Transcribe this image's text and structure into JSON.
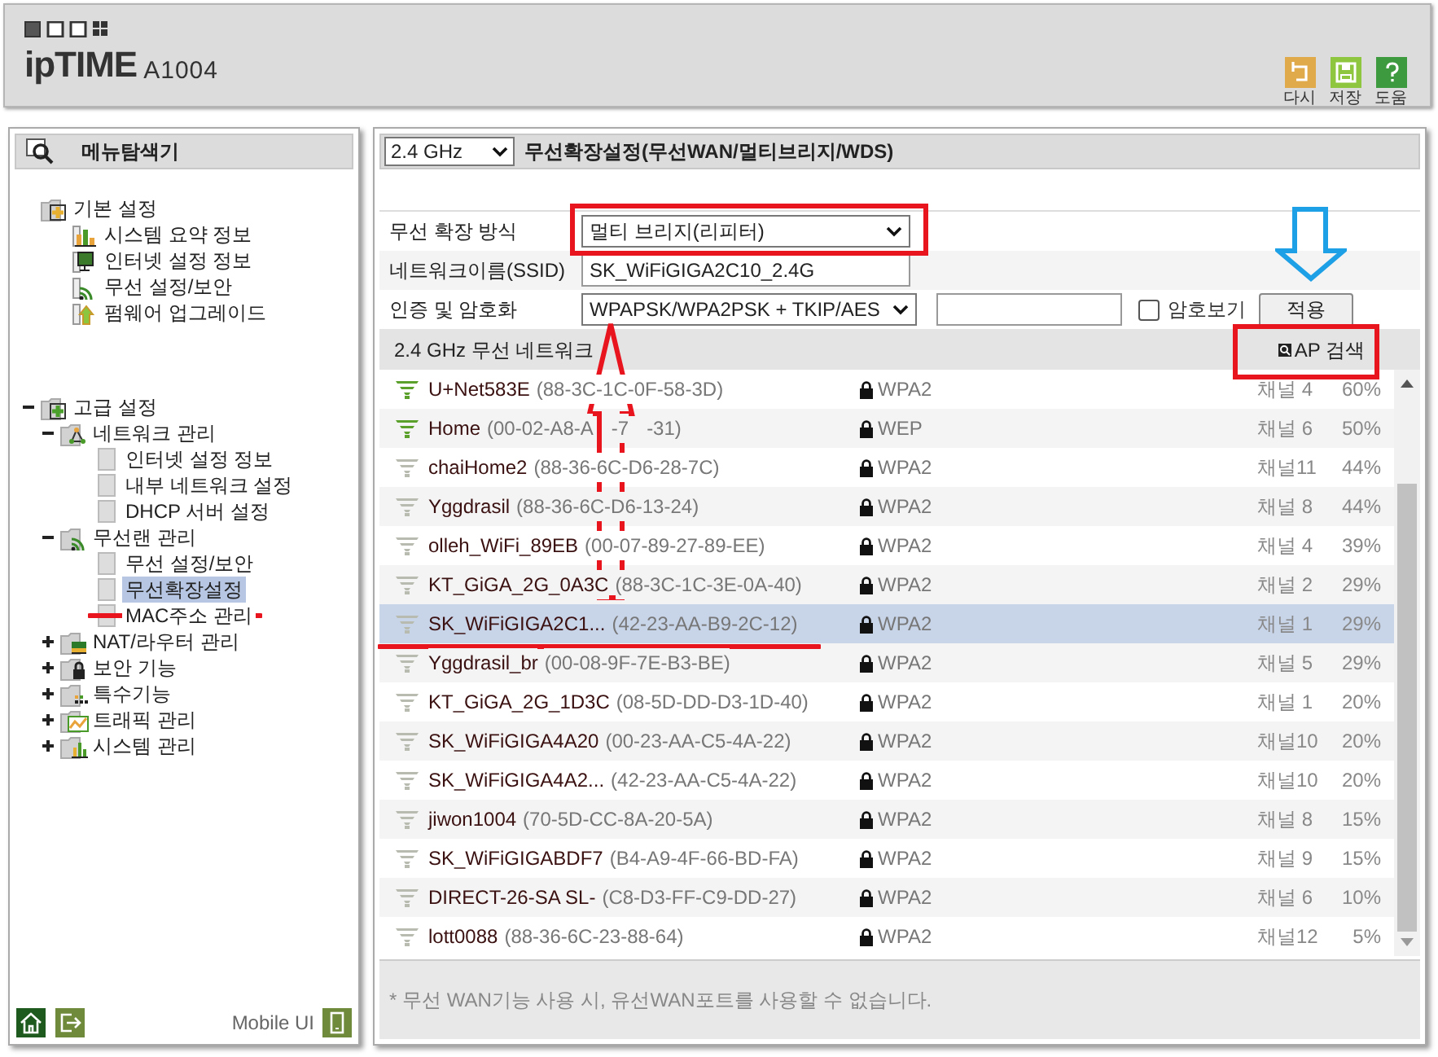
{
  "header": {
    "logo": "ipTIME",
    "model": "A1004",
    "actions": [
      {
        "label": "다시",
        "kind": "undo"
      },
      {
        "label": "저장",
        "kind": "save"
      },
      {
        "label": "도움",
        "kind": "help"
      }
    ]
  },
  "sidebar": {
    "title": "메뉴탐색기",
    "tree": [
      {
        "label": "기본 설정",
        "children": [
          {
            "label": "시스템 요약 정보",
            "selected": false
          },
          {
            "label": "인터넷 설정 정보",
            "selected": false
          },
          {
            "label": "무선 설정/보안",
            "selected": false
          },
          {
            "label": "펌웨어 업그레이드",
            "selected": false
          }
        ]
      },
      {
        "label": "고급 설정",
        "expanded": true,
        "children": [
          {
            "label": "네트워크 관리",
            "expanded": true,
            "children": [
              {
                "label": "인터넷 설정 정보",
                "selected": false
              },
              {
                "label": "내부 네트워크 설정",
                "selected": false
              },
              {
                "label": "DHCP 서버 설정",
                "selected": false
              }
            ]
          },
          {
            "label": "무선랜 관리",
            "expanded": true,
            "children": [
              {
                "label": "무선 설정/보안",
                "selected": false
              },
              {
                "label": "무선확장설정",
                "selected": true
              },
              {
                "label": "MAC주소 관리",
                "selected": false
              }
            ]
          },
          {
            "label": "NAT/라우터 관리",
            "expanded": false
          },
          {
            "label": "보안 기능",
            "expanded": false
          },
          {
            "label": "특수기능",
            "expanded": false
          },
          {
            "label": "트래픽 관리",
            "expanded": false
          },
          {
            "label": "시스템 관리",
            "expanded": false
          }
        ]
      }
    ],
    "mobile_label": "Mobile UI"
  },
  "main": {
    "band": "2.4 GHz",
    "title": "무선확장설정(무선WAN/멀티브리지/WDS)",
    "form": {
      "mode_label": "무선 확장 방식",
      "mode": "멀티 브리지(리피터)",
      "ssid_label": "네트워크이름(SSID)",
      "ssid": "SK_WiFiGIGA2C10_2.4G",
      "auth_label": "인증 및 암호화",
      "auth": "WPAPSK/WPA2PSK + TKIP/AES",
      "show_password_label": "암호보기",
      "show_password": false,
      "apply": "적용"
    },
    "list_title": "2.4 GHz 무선 네트워크",
    "scan_button": "AP 검색",
    "networks": [
      {
        "name": "U+Net583E",
        "bssid": "(88-3C-1C-0F-58-3D)",
        "security": "WPA2",
        "channel": "채널 4",
        "signal": "60%",
        "strong": true,
        "selected": false
      },
      {
        "name": "Home",
        "bssid_parts": [
          "(00-02-A8-A",
          "-7",
          "-31)"
        ],
        "security": "WEP",
        "channel": "채널 6",
        "signal": "50%",
        "strong": true,
        "selected": false
      },
      {
        "name": "chaiHome2",
        "bssid": "(88-36-6C-D6-28-7C)",
        "security": "WPA2",
        "channel": "채널11",
        "signal": "44%",
        "strong": false,
        "selected": false
      },
      {
        "name": "Yggdrasil",
        "bssid": "(88-36-6C-D6-13-24)",
        "security": "WPA2",
        "channel": "채널 8",
        "signal": "44%",
        "strong": false,
        "selected": false
      },
      {
        "name": "olleh_WiFi_89EB",
        "bssid": "(00-07-89-27-89-EE)",
        "security": "WPA2",
        "channel": "채널 4",
        "signal": "39%",
        "strong": false,
        "selected": false
      },
      {
        "name": "KT_GiGA_2G_0A3C",
        "bssid": "(88-3C-1C-3E-0A-40)",
        "security": "WPA2",
        "channel": "채널 2",
        "signal": "29%",
        "strong": false,
        "selected": false
      },
      {
        "name": "SK_WiFiGIGA2C1...",
        "bssid": "(42-23-AA-B9-2C-12)",
        "security": "WPA2",
        "channel": "채널 1",
        "signal": "29%",
        "strong": false,
        "selected": true
      },
      {
        "name": "Yggdrasil_br",
        "bssid": "(00-08-9F-7E-B3-BE)",
        "security": "WPA2",
        "channel": "채널 5",
        "signal": "29%",
        "strong": false,
        "selected": false
      },
      {
        "name": "KT_GiGA_2G_1D3C",
        "bssid": "(08-5D-DD-D3-1D-40)",
        "security": "WPA2",
        "channel": "채널 1",
        "signal": "20%",
        "strong": false,
        "selected": false
      },
      {
        "name": "SK_WiFiGIGA4A20",
        "bssid": "(00-23-AA-C5-4A-22)",
        "security": "WPA2",
        "channel": "채널10",
        "signal": "20%",
        "strong": false,
        "selected": false
      },
      {
        "name": "SK_WiFiGIGA4A2...",
        "bssid": "(42-23-AA-C5-4A-22)",
        "security": "WPA2",
        "channel": "채널10",
        "signal": "20%",
        "strong": false,
        "selected": false
      },
      {
        "name": "jiwon1004",
        "bssid": "(70-5D-CC-8A-20-5A)",
        "security": "WPA2",
        "channel": "채널 8",
        "signal": "15%",
        "strong": false,
        "selected": false
      },
      {
        "name": "SK_WiFiGIGABDF7",
        "bssid": "(B4-A9-4F-66-BD-FA)",
        "security": "WPA2",
        "channel": "채널 9",
        "signal": "15%",
        "strong": false,
        "selected": false
      },
      {
        "name": "DIRECT-26-SA SL-",
        "bssid": "(C8-D3-FF-C9-DD-27)",
        "security": "WPA2",
        "channel": "채널 6",
        "signal": "10%",
        "strong": false,
        "selected": false
      },
      {
        "name": "lott0088",
        "bssid": "(88-36-6C-23-88-64)",
        "security": "WPA2",
        "channel": "채널12",
        "signal": "5%",
        "strong": false,
        "selected": false
      }
    ],
    "note": "* 무선 WAN기능 사용 시, 유선WAN포트를 사용할 수 없습니다."
  }
}
